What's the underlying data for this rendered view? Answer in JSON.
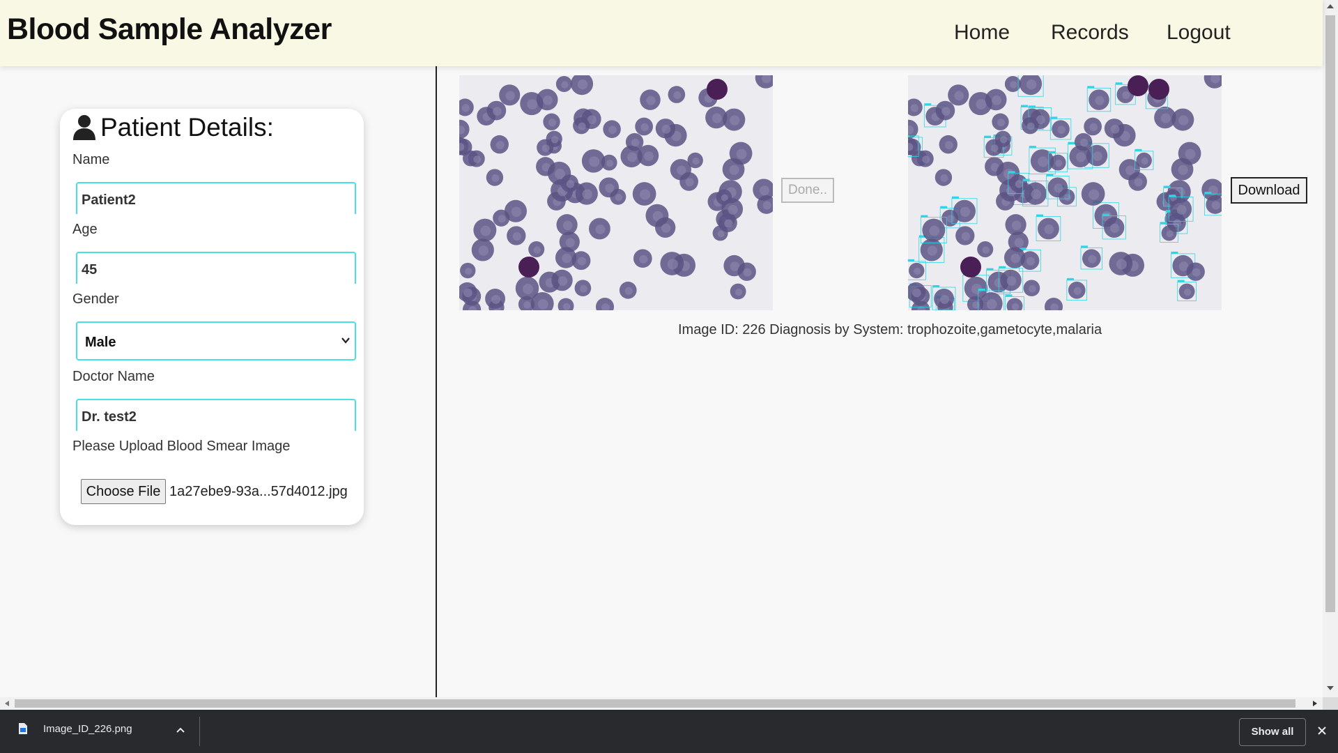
{
  "header": {
    "title": "Blood Sample Analyzer",
    "nav": {
      "home": "Home",
      "records": "Records",
      "logout": "Logout"
    }
  },
  "patient_form": {
    "title": "Patient Details:",
    "name_label": "Name",
    "name_value": "Patient2",
    "age_label": "Age",
    "age_value": "45",
    "gender_label": "Gender",
    "gender_value": "Male",
    "doctor_label": "Doctor Name",
    "doctor_value": "Dr. test2",
    "upload_label": "Please Upload Blood Smear Image",
    "choose_file_label": "Choose File",
    "file_name": "1a27ebe9-93a...57d4012.jpg"
  },
  "results": {
    "done_label": "Done..",
    "download_label": "Download",
    "diagnosis_text": "Image ID: 226 Diagnosis by System: trophozoite,gametocyte,malaria"
  },
  "download_bar": {
    "file_name": "Image_ID_226.png",
    "show_all_label": "Show all"
  },
  "colors": {
    "header_bg": "#f8f8e4",
    "input_border": "#48e0e0",
    "cell_color": "#5a5484",
    "box_color": "#2fd5e6"
  },
  "icons": [
    "user-icon",
    "chevron-down-icon",
    "file-icon",
    "caret-up-icon",
    "close-icon"
  ]
}
